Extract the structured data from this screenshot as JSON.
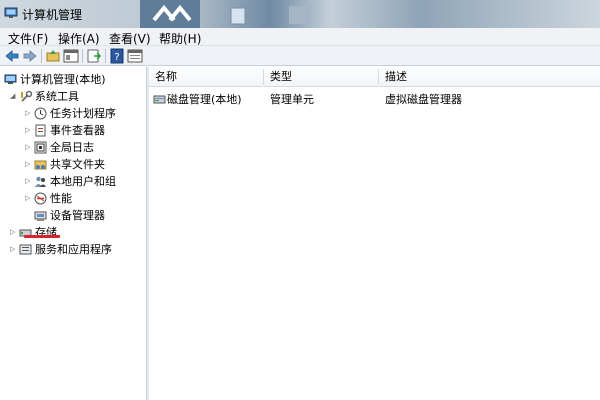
{
  "window": {
    "title": "计算机管理"
  },
  "menu": [
    {
      "label": "文件(F)"
    },
    {
      "label": "操作(A)"
    },
    {
      "label": "查看(V)"
    },
    {
      "label": "帮助(H)"
    }
  ],
  "toolbar": {
    "buttons": [
      "back-arrow-icon",
      "forward-arrow-icon",
      "up-folder-icon",
      "show-hide-tree-icon",
      "export-list-icon",
      "help-icon",
      "properties-icon"
    ]
  },
  "tree": {
    "root": "计算机管理(本地)",
    "system_tools": "系统工具",
    "items": [
      {
        "label": "任务计划程序"
      },
      {
        "label": "事件查看器"
      },
      {
        "label": "全局日志"
      },
      {
        "label": "共享文件夹"
      },
      {
        "label": "本地用户和组"
      },
      {
        "label": "性能"
      },
      {
        "label": "设备管理器"
      }
    ],
    "storage": "存储",
    "services": "服务和应用程序"
  },
  "list": {
    "columns": [
      "名称",
      "类型",
      "描述"
    ],
    "rows": [
      {
        "name": "磁盘管理(本地)",
        "type": "管理单元",
        "desc": "虚拟磁盘管理器"
      }
    ]
  },
  "colors": {
    "underline": "#d9232b",
    "accent": "#1e5aa8"
  }
}
